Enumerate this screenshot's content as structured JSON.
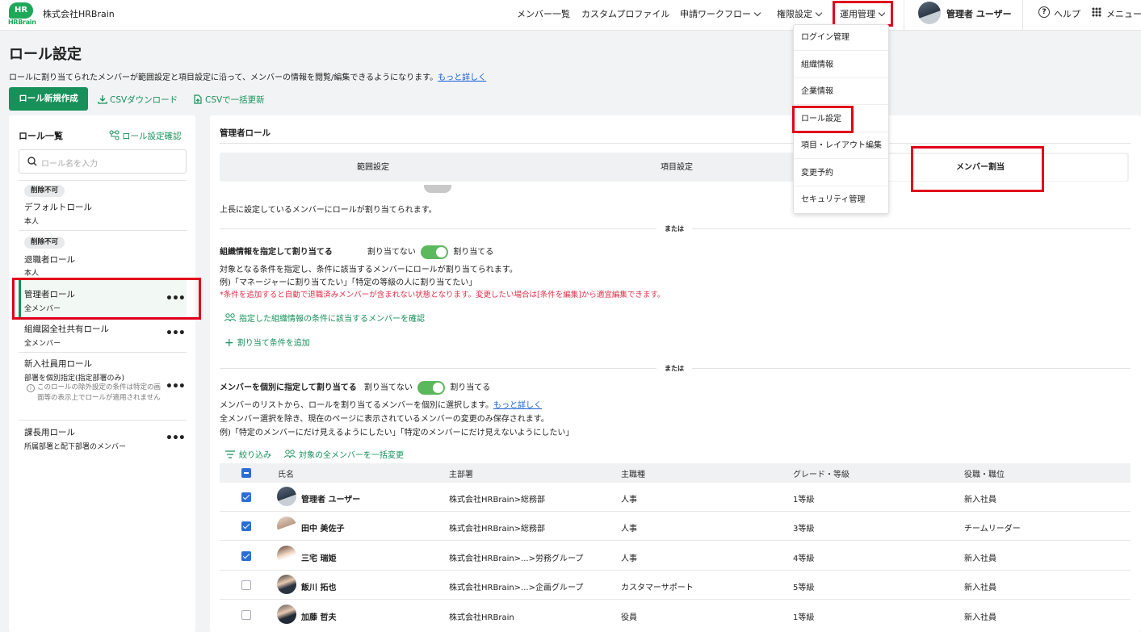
{
  "header": {
    "logo_text": "HR",
    "logo_sub": "HRBrain",
    "company": "株式会社HRBrain",
    "nav": {
      "members": "メンバー一覧",
      "custom_profile": "カスタムプロファイル",
      "workflow": "申請ワークフロー",
      "permissions": "権限設定",
      "operations": "運用管理"
    },
    "user": "管理者 ユーザー",
    "help": "ヘルプ",
    "menu": "メニュー"
  },
  "dropdown": [
    "ログイン管理",
    "組織情報",
    "企業情報",
    "ロール設定",
    "項目・レイアウト編集",
    "変更予約",
    "セキュリティ管理"
  ],
  "page": {
    "title": "ロール設定",
    "desc": "ロールに割り当てられたメンバーが範囲設定と項目設定に沿って、メンバーの情報を閲覧/編集できるようになります。",
    "desc_link": "もっと詳しく",
    "new_role": "ロール新規作成",
    "csv_download": "CSVダウンロード",
    "csv_update": "CSVで一括更新"
  },
  "sidebar": {
    "title": "ロール一覧",
    "confirm": "ロール設定確認",
    "search_placeholder": "ロール名を入力",
    "roles": [
      {
        "badge": "削除不可",
        "name": "デフォルトロール",
        "desc": "本人"
      },
      {
        "badge": "削除不可",
        "name": "退職者ロール",
        "desc": "本人"
      },
      {
        "name": "管理者ロール",
        "desc": "全メンバー"
      },
      {
        "name": "組織図全社共有ロール",
        "desc": "全メンバー"
      },
      {
        "name": "新入社員用ロール",
        "desc": "部署を個別指定(指定部署のみ)",
        "note": "このロールの除外設定の条件は特定の画面等の表示上でロールが適用されません"
      },
      {
        "name": "課長用ロール",
        "desc": "所属部署と配下部署のメンバー"
      }
    ]
  },
  "main": {
    "role_title": "管理者ロール",
    "tabs": [
      "範囲設定",
      "項目設定",
      "メンバー割当"
    ],
    "supervisor_text": "上長に設定しているメンバーにロールが割り当てられます。",
    "or": "または",
    "org": {
      "title": "組織情報を指定して割り当てる",
      "off": "割り当てない",
      "on": "割り当てる",
      "line1": "対象となる条件を指定し、条件に該当するメンバーにロールが割り当てられます。",
      "line2": "例)「マネージャーに割り当てたい」「特定の等級の人に割り当てたい」",
      "warn": "*条件を追加すると自動で退職済みメンバーが含まれない状態となります。変更したい場合は[条件を編集]から適宜編集できます。",
      "check": "指定した組織情報の条件に該当するメンバーを確認",
      "add": "割り当て条件を追加"
    },
    "indiv": {
      "title": "メンバーを個別に指定して割り当てる",
      "off": "割り当てない",
      "on": "割り当てる",
      "line1": "メンバーのリストから、ロールを割り当てるメンバーを個別に選択します。",
      "link": "もっと詳しく",
      "line2": "全メンバー選択を除き、現在のページに表示されているメンバーの変更のみ保存されます。",
      "line3": "例)「特定のメンバーにだけ見えるようにしたい」「特定のメンバーにだけ見えないようにしたい」",
      "filter": "絞り込み",
      "bulk": "対象の全メンバーを一括変更"
    },
    "columns": [
      "氏名",
      "主部署",
      "主職種",
      "グレード・等級",
      "役職・職位"
    ],
    "rows": [
      {
        "checked": true,
        "name": "管理者 ユーザー",
        "dept": "株式会社HRBrain>総務部",
        "job": "人事",
        "grade": "1等級",
        "pos": "新入社員"
      },
      {
        "checked": true,
        "name": "田中 美佐子",
        "dept": "株式会社HRBrain>総務部",
        "job": "人事",
        "grade": "3等級",
        "pos": "チームリーダー"
      },
      {
        "checked": true,
        "name": "三宅 瑞姫",
        "dept": "株式会社HRBrain>...>労務グループ",
        "job": "人事",
        "grade": "4等級",
        "pos": "新入社員"
      },
      {
        "checked": false,
        "name": "飯川 拓也",
        "dept": "株式会社HRBrain>...>企画グループ",
        "job": "カスタマーサポート",
        "grade": "5等級",
        "pos": "新入社員"
      },
      {
        "checked": false,
        "name": "加藤 哲夫",
        "dept": "株式会社HRBrain",
        "job": "役員",
        "grade": "1等級",
        "pos": "新入社員"
      }
    ]
  },
  "colors": {
    "accent": "#17905a",
    "highlight": "#e0001b",
    "checkbox": "#2c6ed6"
  }
}
